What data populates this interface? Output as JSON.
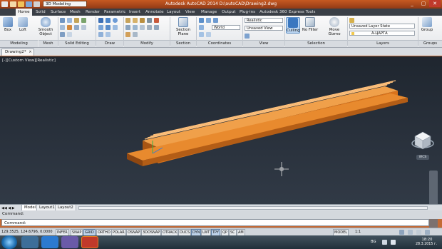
{
  "colors": {
    "accent": "#d9731b",
    "model": "#e58a2a",
    "model_dark": "#9a4f12",
    "viewport_bg": "#28303a",
    "titlebar": "#b24e1d"
  },
  "titlebar": {
    "workspace": "3D Modeling",
    "title": "Autodesk AutoCAD 2014   D:\\autoCAD\\Drawing2.dwg",
    "search_placeholder": "Type a keyword or phrase",
    "user": "Sign In",
    "window_buttons": [
      "_",
      "▢",
      "✕"
    ]
  },
  "ribbon_tabs": [
    "Home",
    "Solid",
    "Surface",
    "Mesh",
    "Render",
    "Parametric",
    "Insert",
    "Annotate",
    "Layout",
    "View",
    "Manage",
    "Output",
    "Plug-ins",
    "Autodesk 360",
    "Express Tools"
  ],
  "active_ribbon_tab": "Home",
  "ribbon": {
    "modeling": {
      "label": "Modeling",
      "buttons": [
        "Box",
        "Loft",
        "Smooth Object"
      ]
    },
    "mesh": {
      "label": "Mesh"
    },
    "solid_editing": {
      "label": "Solid Editing"
    },
    "draw": {
      "label": "Draw"
    },
    "modify": {
      "label": "Modify"
    },
    "section": {
      "label": "Section",
      "button": "Section Plane"
    },
    "coordinates": {
      "label": "Coordinates",
      "combo": "World"
    },
    "view": {
      "label": "View",
      "visual_style": "Realistic",
      "view_combo": "Unsaved View"
    },
    "selection": {
      "label": "Selection",
      "culling": "Culling",
      "filter": "No Filter",
      "gizmo": "Move Gizmo"
    },
    "layers": {
      "label": "Layers",
      "layer_state": "Unsaved Layer State",
      "layer": "A-ЦАРГА"
    },
    "groups": {
      "label": "Groups",
      "button": "Group"
    }
  },
  "document_tab": "Drawing2*",
  "viewport": {
    "label": "[-][Custom View][Realistic]",
    "viewcube_label": "WCS"
  },
  "layout_tabs": [
    "Model",
    "Layout1",
    "Layout2"
  ],
  "active_layout_tab": "Model",
  "command": {
    "prompt": "Command:",
    "history": "Command:"
  },
  "status": {
    "coordinates": "129.3525, 124.6796, 0.0000",
    "toggles": [
      {
        "label": "INFER",
        "on": false
      },
      {
        "label": "SNAP",
        "on": false
      },
      {
        "label": "GRID",
        "on": true
      },
      {
        "label": "ORTHO",
        "on": false
      },
      {
        "label": "POLAR",
        "on": false
      },
      {
        "label": "OSNAP",
        "on": false
      },
      {
        "label": "3DOSNAP",
        "on": false
      },
      {
        "label": "OTRACK",
        "on": false
      },
      {
        "label": "DUCS",
        "on": false
      },
      {
        "label": "DYN",
        "on": true
      },
      {
        "label": "LWT",
        "on": false
      },
      {
        "label": "TPY",
        "on": true
      },
      {
        "label": "QP",
        "on": false
      },
      {
        "label": "SC",
        "on": false
      },
      {
        "label": "AM",
        "on": false
      }
    ],
    "model_label": "MODEL",
    "scale": "1:1"
  },
  "taskbar": {
    "language": "BG",
    "time": "18:20",
    "date": "28.3.2015 г."
  }
}
